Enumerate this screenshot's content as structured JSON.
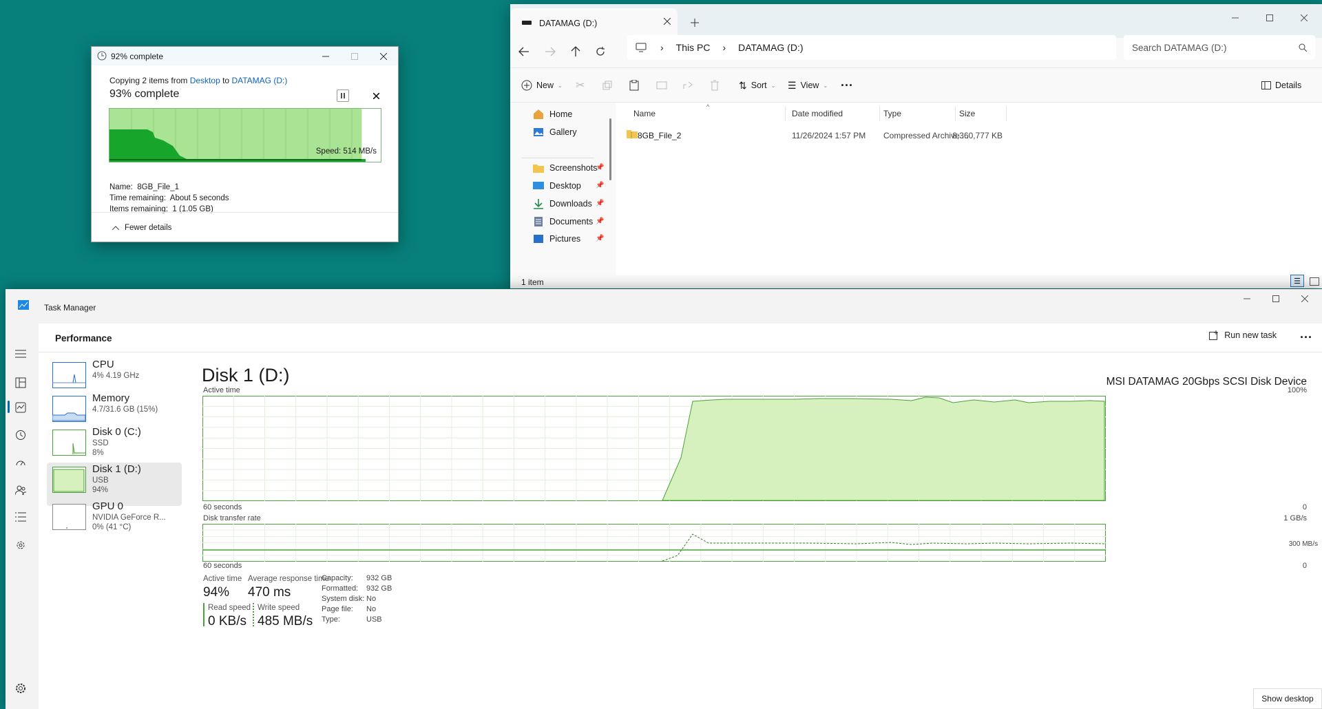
{
  "copy_dialog": {
    "title": "92% complete",
    "line_prefix": "Copying 2 items from",
    "source": "Desktop",
    "to": "to",
    "destination": "DATAMAG (D:)",
    "percent": "93% complete",
    "progress": 0.93,
    "speed": "Speed: 514 MB/s",
    "name_label": "Name:",
    "name": "8GB_File_1",
    "time_label": "Time remaining:",
    "time": "About 5 seconds",
    "items_label": "Items remaining:",
    "items": "1 (1.05 GB)",
    "fewer": "Fewer details"
  },
  "explorer": {
    "tab_title": "DATAMAG (D:)",
    "breadcrumb": [
      "This PC",
      "DATAMAG (D:)"
    ],
    "search_placeholder": "Search DATAMAG (D:)",
    "new": "New",
    "sort": "Sort",
    "view": "View",
    "details": "Details",
    "nav": [
      {
        "label": "Home",
        "icon": "home-icon"
      },
      {
        "label": "Gallery",
        "icon": "gallery-icon"
      },
      {
        "label": "Screenshots",
        "icon": "folder-icon"
      },
      {
        "label": "Desktop",
        "icon": "desktop-icon"
      },
      {
        "label": "Downloads",
        "icon": "download-icon"
      },
      {
        "label": "Documents",
        "icon": "document-icon"
      },
      {
        "label": "Pictures",
        "icon": "pictures-icon"
      }
    ],
    "columns": [
      "Name",
      "Date modified",
      "Type",
      "Size"
    ],
    "rows": [
      {
        "name": "8GB_File_2",
        "date": "11/26/2024 1:57 PM",
        "type": "Compressed Archive ...",
        "size": "8,360,777 KB"
      }
    ],
    "status": "1 item"
  },
  "task_manager": {
    "title": "Task Manager",
    "section": "Performance",
    "run_task": "Run new task",
    "items": [
      {
        "name": "CPU",
        "l1": "4% 4.19 GHz",
        "l2": ""
      },
      {
        "name": "Memory",
        "l1": "4.7/31.6 GB (15%)",
        "l2": ""
      },
      {
        "name": "Disk 0 (C:)",
        "l1": "SSD",
        "l2": "8%"
      },
      {
        "name": "Disk 1 (D:)",
        "l1": "USB",
        "l2": "94%"
      },
      {
        "name": "GPU 0",
        "l1": "NVIDIA GeForce R...",
        "l2": "0% (41 °C)"
      }
    ],
    "disk_title": "Disk 1 (D:)",
    "model": "MSI DATAMAG 20Gbps SCSI Disk Device",
    "active_time_label": "Active time",
    "max_100": "100%",
    "sixty": "60 seconds",
    "zero": "0",
    "transfer_label": "Disk transfer rate",
    "transfer_max": "1 GB/s",
    "transfer_mark": "300 MB/s",
    "stats": {
      "active_label": "Active time",
      "active": "94%",
      "resp_label": "Average response time",
      "resp": "470 ms",
      "read_label": "Read speed",
      "read": "0 KB/s",
      "write_label": "Write speed",
      "write": "485 MB/s"
    },
    "props": [
      [
        "Capacity:",
        "932 GB"
      ],
      [
        "Formatted:",
        "932 GB"
      ],
      [
        "System disk:",
        "No"
      ],
      [
        "Page file:",
        "No"
      ],
      [
        "Type:",
        "USB"
      ]
    ],
    "show_desktop": "Show desktop"
  },
  "colors": {
    "teal": "#077f7b",
    "green": "#4ca23a",
    "green_fill": "#d6f1bd",
    "copy_green": "#9de08b",
    "copy_dark": "#19a92f",
    "link": "#0e63b8"
  }
}
